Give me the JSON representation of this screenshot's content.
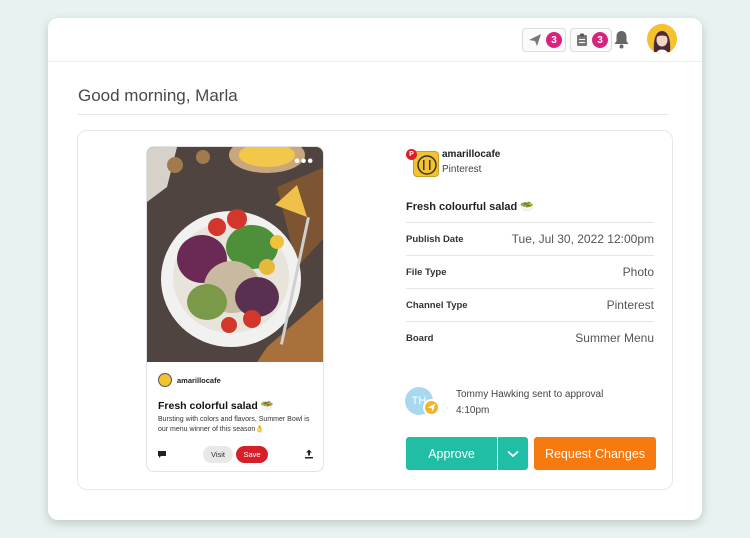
{
  "topbar": {
    "approvals_icon": "paper-plane-icon",
    "approvals_count": "3",
    "tasks_icon": "clipboard-icon",
    "tasks_count": "3",
    "notifications_icon": "bell-icon",
    "avatar": "user-avatar"
  },
  "greeting": "Good morning, Marla",
  "pin_preview": {
    "more_label": "•••",
    "account_name": "amarillocafe",
    "title": "Fresh colorful salad 🥗",
    "description": "Bursting with colors and flavors, Summer Bowl is our menu winner of this season👌",
    "visit_label": "Visit",
    "save_label": "Save",
    "comment_icon": "comment-icon",
    "share_icon": "share-icon"
  },
  "post": {
    "account_name": "amarillocafe",
    "channel": "Pinterest",
    "title": "Fresh colourful salad 🥗",
    "details": [
      {
        "label": "Publish Date",
        "value": "Tue, Jul 30, 2022 12:00pm"
      },
      {
        "label": "File Type",
        "value": "Photo"
      },
      {
        "label": "Channel Type",
        "value": "Pinterest"
      },
      {
        "label": "Board",
        "value": "Summer Menu"
      }
    ]
  },
  "approval": {
    "initials": "TH",
    "message": "Tommy Hawking sent to approval",
    "time": "4:10pm"
  },
  "actions": {
    "approve_label": "Approve",
    "request_changes_label": "Request Changes"
  },
  "colors": {
    "approve": "#20bfa5",
    "request_changes": "#f77a10",
    "badge": "#d6247e",
    "pinterest": "#d71f29"
  }
}
